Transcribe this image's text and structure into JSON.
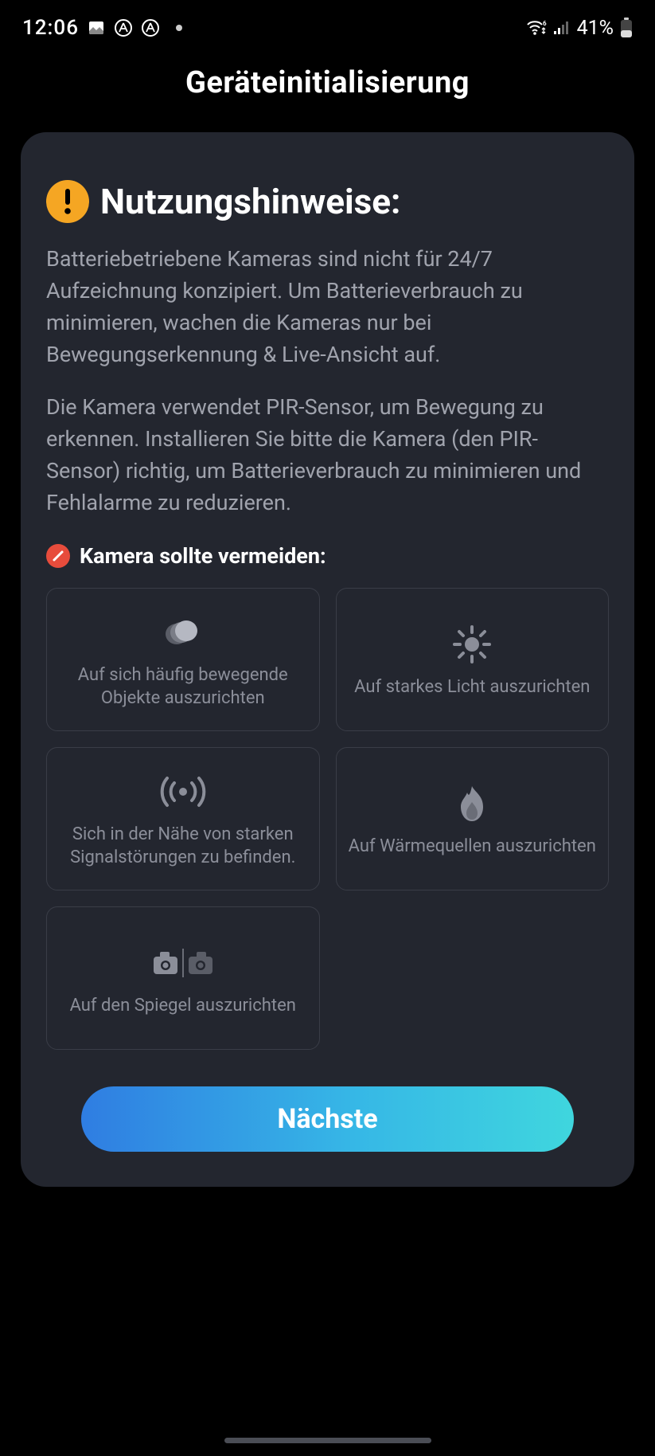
{
  "status": {
    "time": "12:06",
    "battery_text": "41%"
  },
  "page_title": "Geräteinitialisierung",
  "card": {
    "heading": "Nutzungshinweise:",
    "paragraph1": "Batteriebetriebene Kameras sind nicht für 24/7 Aufzeichnung konzipiert. Um Batterieverbrauch zu minimieren, wachen die Kameras nur bei Bewegungserkennung & Live-Ansicht auf.",
    "paragraph2": "Die Kamera verwendet PIR-Sensor, um Bewegung zu erkennen. Installieren Sie bitte die Kamera (den PIR-Sensor) richtig, um Batterieverbrauch zu minimieren und Fehlalarme zu reduzieren.",
    "avoid_label": "Kamera sollte vermeiden:",
    "tiles": [
      {
        "label": "Auf sich häufig bewegende Objekte auszurichten"
      },
      {
        "label": "Auf starkes Licht auszurichten"
      },
      {
        "label": "Sich in der Nähe von starken Signalstörungen zu befinden."
      },
      {
        "label": "Auf Wärmequellen auszurichten"
      },
      {
        "label": "Auf den Spiegel auszurichten"
      }
    ],
    "next_button": "Nächste"
  }
}
